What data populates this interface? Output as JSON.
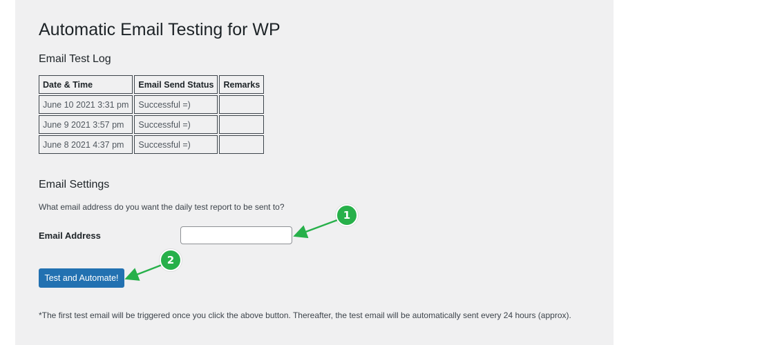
{
  "page": {
    "title": "Automatic Email Testing for WP"
  },
  "log": {
    "title": "Email Test Log",
    "columns": [
      "Date & Time",
      "Email Send Status",
      "Remarks"
    ],
    "rows": [
      {
        "date": "June 10 2021 3:31 pm",
        "status": "Successful =)",
        "remarks": ""
      },
      {
        "date": "June 9 2021 3:57 pm",
        "status": "Successful =)",
        "remarks": ""
      },
      {
        "date": "June 8 2021 4:37 pm",
        "status": "Successful =)",
        "remarks": ""
      }
    ]
  },
  "settings": {
    "title": "Email Settings",
    "question": "What email address do you want the daily test report to be sent to?",
    "email_label": "Email Address",
    "email_value": "",
    "button_label": "Test and Automate!",
    "footnote": "*The first test email will be triggered once you click the above button. Thereafter, the test email will be automatically sent every 24 hours (approx)."
  },
  "annotations": {
    "badge_1": "1",
    "badge_2": "2",
    "color": "#27b04a"
  },
  "colors": {
    "panel_bg": "#f0f0f1",
    "button_bg": "#2271b1",
    "text": "#1d2327"
  }
}
